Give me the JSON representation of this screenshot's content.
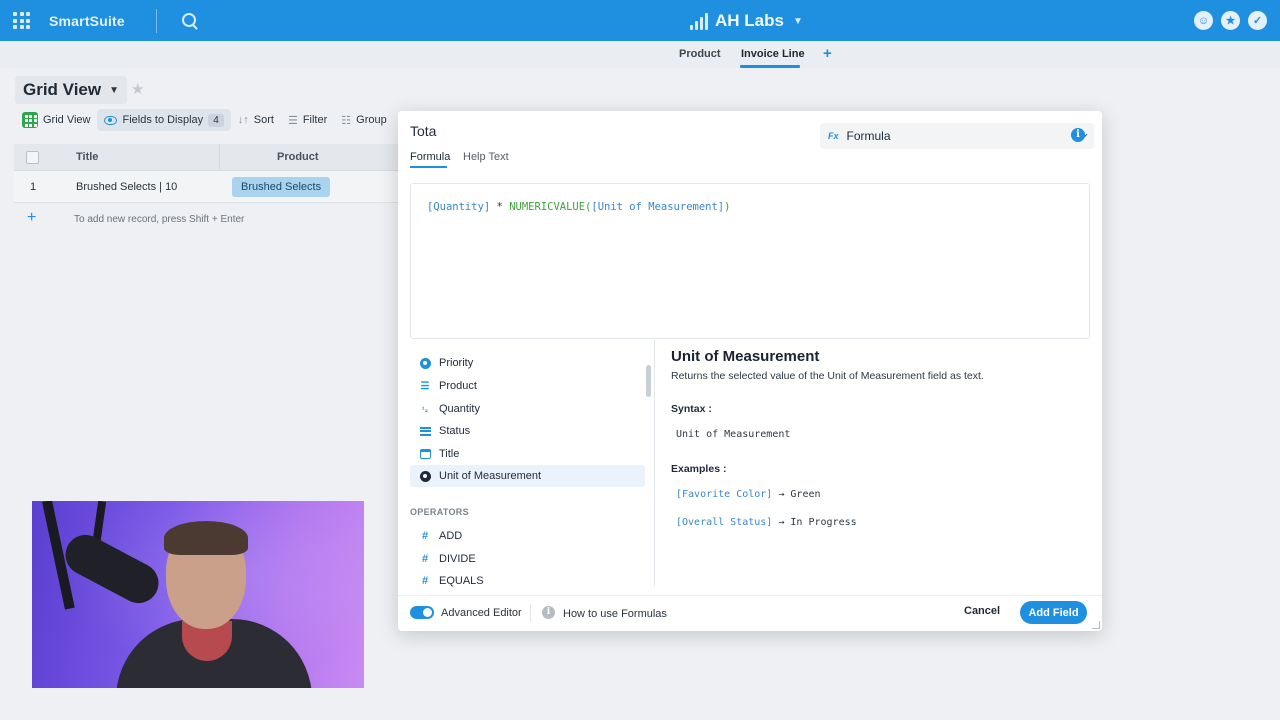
{
  "app": {
    "brand": "SmartSuite",
    "workspace": "AH Labs",
    "colors": {
      "primary": "#1f8fe0",
      "tag_bg": "#a9d3ee",
      "success": "#2aa84a"
    },
    "top_right_icons": [
      "team-icon",
      "star-icon",
      "check-icon"
    ]
  },
  "tabs": [
    {
      "label": "Product",
      "active": false
    },
    {
      "label": "Invoice Line",
      "active": true
    }
  ],
  "view": {
    "name": "Grid View",
    "toolbar": {
      "grid_view": "Grid View",
      "fields": "Fields to Display",
      "fields_count": "4",
      "sort": "Sort",
      "filter": "Filter",
      "group": "Group"
    },
    "columns": [
      "Title",
      "Product"
    ],
    "rows": [
      {
        "num": "1",
        "title": "Brushed Selects | 10",
        "product": "Brushed Selects"
      }
    ],
    "add_hint": "To add new record, press Shift + Enter"
  },
  "modal": {
    "field_name": "Tota",
    "tabs": [
      "Formula",
      "Help Text"
    ],
    "field_type": {
      "icon": "Fx",
      "label": "Formula"
    },
    "formula": {
      "t1": "[Quantity]",
      "t2": " * ",
      "t3": "NUMERICVALUE(",
      "t4": "[Unit of Measurement]",
      "t5": ")"
    },
    "fields_list": [
      {
        "label": "Priority",
        "icon": "priority-icon"
      },
      {
        "label": "Product",
        "icon": "linked-record-icon"
      },
      {
        "label": "Quantity",
        "icon": "number-icon"
      },
      {
        "label": "Status",
        "icon": "status-icon"
      },
      {
        "label": "Title",
        "icon": "title-icon"
      },
      {
        "label": "Unit of Measurement",
        "icon": "single-select-icon",
        "selected": true
      }
    ],
    "operators_label": "OPERATORS",
    "operators": [
      "ADD",
      "DIVIDE",
      "EQUALS"
    ],
    "reference": {
      "title": "Unit of Measurement",
      "description": "Returns the selected value of the Unit of Measurement field as text.",
      "syntax_label": "Syntax :",
      "syntax": "Unit of Measurement",
      "examples_label": "Examples :",
      "examples": [
        {
          "expr": "[Favorite Color]",
          "result": "→ Green"
        },
        {
          "expr": "[Overall Status]",
          "result": "→ In Progress"
        }
      ]
    },
    "footer": {
      "advanced_editor": "Advanced Editor",
      "advanced_editor_on": true,
      "help_link": "How to use Formulas",
      "cancel": "Cancel",
      "add": "Add Field"
    }
  }
}
